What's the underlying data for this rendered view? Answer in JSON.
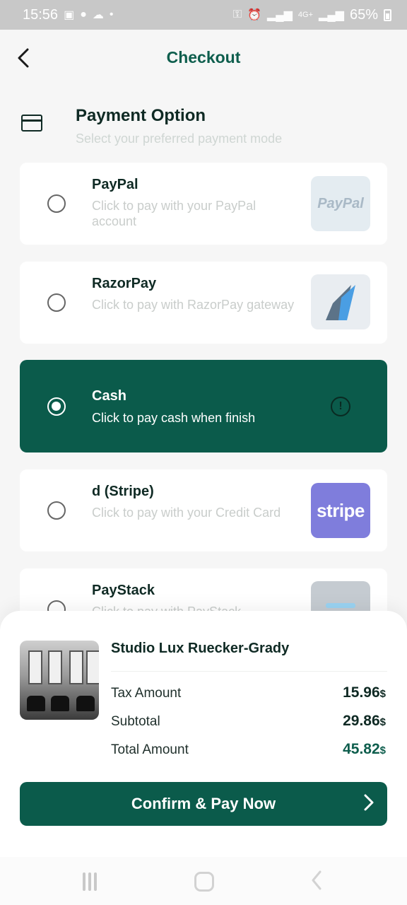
{
  "status_bar": {
    "time": "15:56",
    "network": "4G+",
    "battery": "65%"
  },
  "header": {
    "title": "Checkout"
  },
  "section": {
    "title": "Payment Option",
    "subtitle": "Select your preferred payment mode"
  },
  "payment_options": [
    {
      "name": "PayPal",
      "description": "Click to pay with your PayPal account",
      "logo_text": "PayPal",
      "selected": false
    },
    {
      "name": "RazorPay",
      "description": "Click to pay with RazorPay gateway",
      "selected": false
    },
    {
      "name": "Cash",
      "description": "Click to pay cash when finish",
      "selected": true,
      "info_icon": "!"
    },
    {
      "name": "d (Stripe)",
      "description": "Click to pay with your Credit Card",
      "logo_text": "stripe",
      "selected": false
    },
    {
      "name": "PayStack",
      "description": "Click to pay with PayStack",
      "selected": false
    }
  ],
  "summary": {
    "salon_name": "Studio Lux Ruecker-Grady",
    "rows": [
      {
        "label": "Tax Amount",
        "value": "15.96",
        "currency": "$"
      },
      {
        "label": "Subtotal",
        "value": "29.86",
        "currency": "$"
      },
      {
        "label": "Total Amount",
        "value": "45.82",
        "currency": "$"
      }
    ],
    "confirm_label": "Confirm & Pay Now"
  },
  "colors": {
    "primary": "#0b5b4b",
    "accent_text": "#0e5e4d",
    "stripe": "#7f7ddc"
  },
  "icons": [
    "back-icon",
    "card-icon",
    "radio-icon",
    "info-icon",
    "chevron-right-icon"
  ]
}
